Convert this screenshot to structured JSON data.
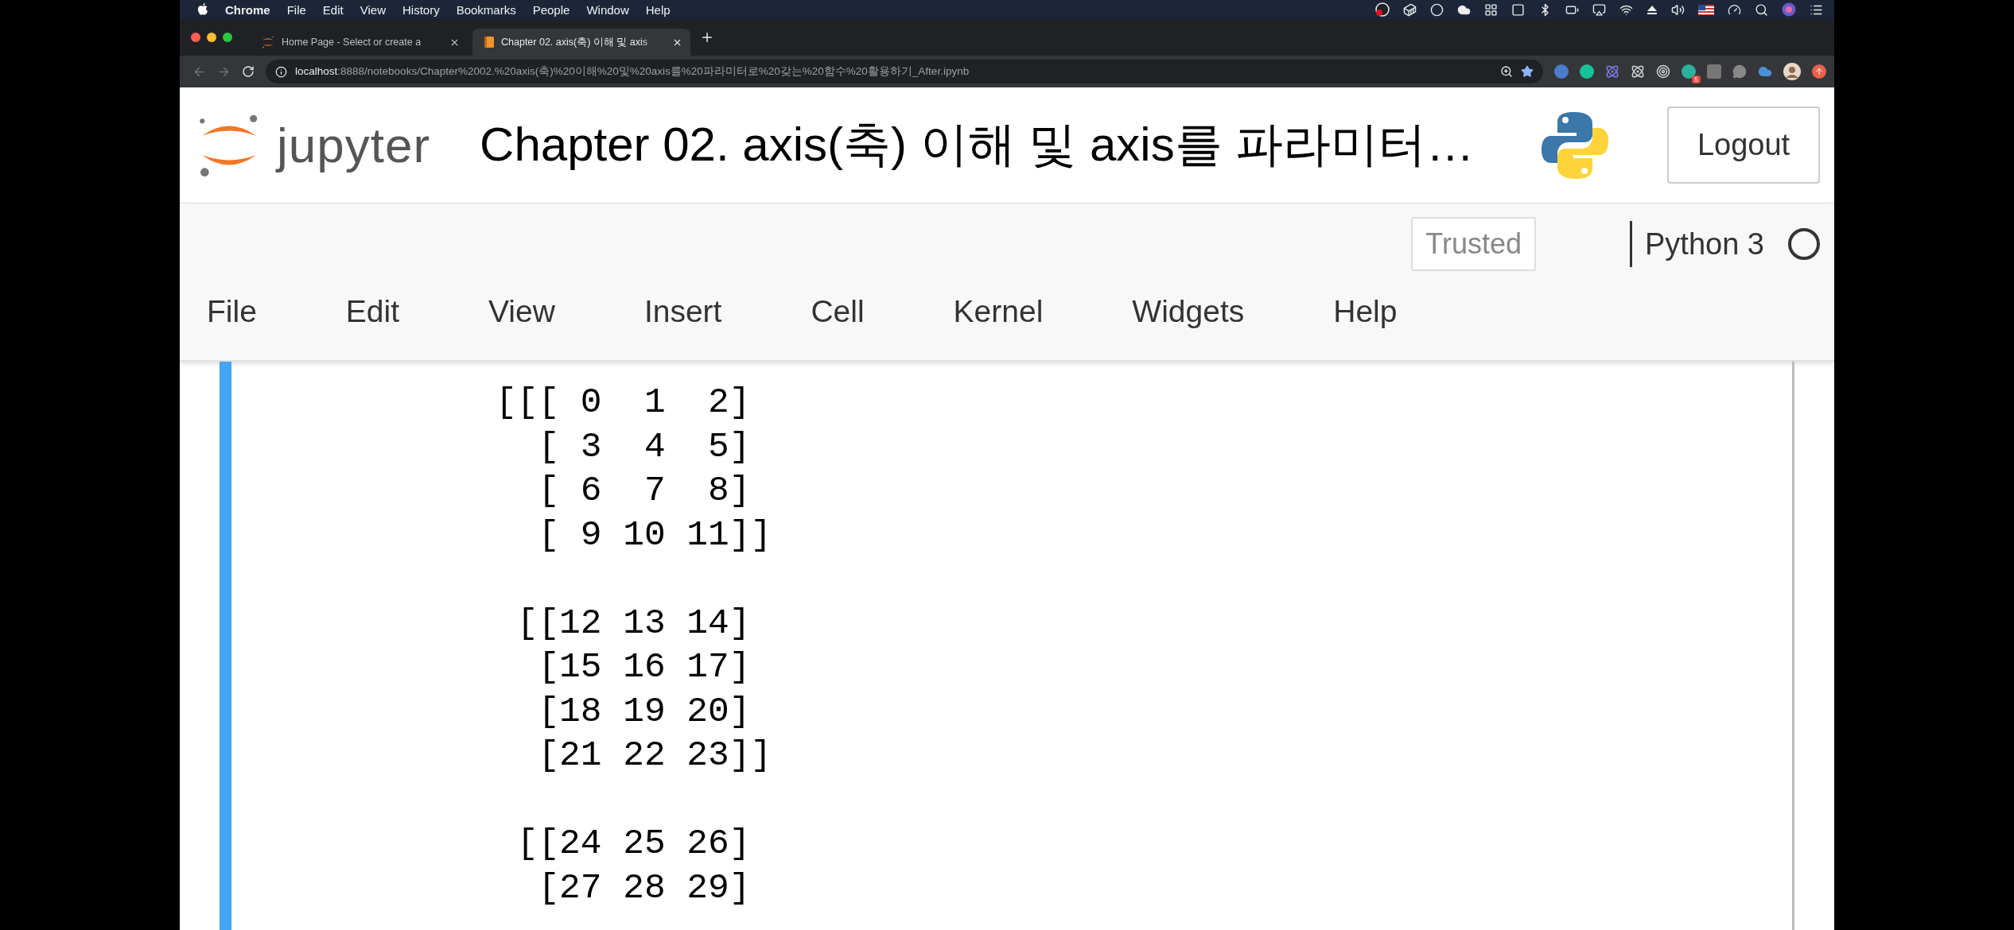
{
  "mac_menubar": {
    "app": "Chrome",
    "items": [
      "File",
      "Edit",
      "View",
      "History",
      "Bookmarks",
      "People",
      "Window",
      "Help"
    ]
  },
  "tabs": [
    {
      "title": "Home Page - Select or create a",
      "selected": false,
      "kind": "jupyter"
    },
    {
      "title": "Chapter 02. axis(축) 이해 및 axis",
      "selected": true,
      "kind": "book"
    }
  ],
  "address_bar": {
    "host": "localhost",
    "path": ":8888/notebooks/Chapter%2002.%20axis(축)%20이해%20및%20axis를%20파라미터로%20갖는%20함수%20활용하기_After.ipynb",
    "extension_badge": "5"
  },
  "notebook_header": {
    "logo_text": "jupyter",
    "title": "Chapter 02. axis(축) 이해 및 axis를 파라미터…",
    "logout": "Logout"
  },
  "toolbar": {
    "trusted": "Trusted",
    "kernel": "Python 3",
    "kernel_idle": true
  },
  "menu": [
    "File",
    "Edit",
    "View",
    "Insert",
    "Cell",
    "Kernel",
    "Widgets",
    "Help"
  ],
  "cell": {
    "selected": true,
    "output_blocks": [
      [
        "[[[ 0  1  2]",
        "  [ 3  4  5]",
        "  [ 6  7  8]",
        "  [ 9 10 11]]"
      ],
      [
        " [[12 13 14]",
        "  [15 16 17]",
        "  [18 19 20]",
        "  [21 22 23]]"
      ],
      [
        " [[24 25 26]",
        "  [27 28 29]"
      ]
    ]
  }
}
